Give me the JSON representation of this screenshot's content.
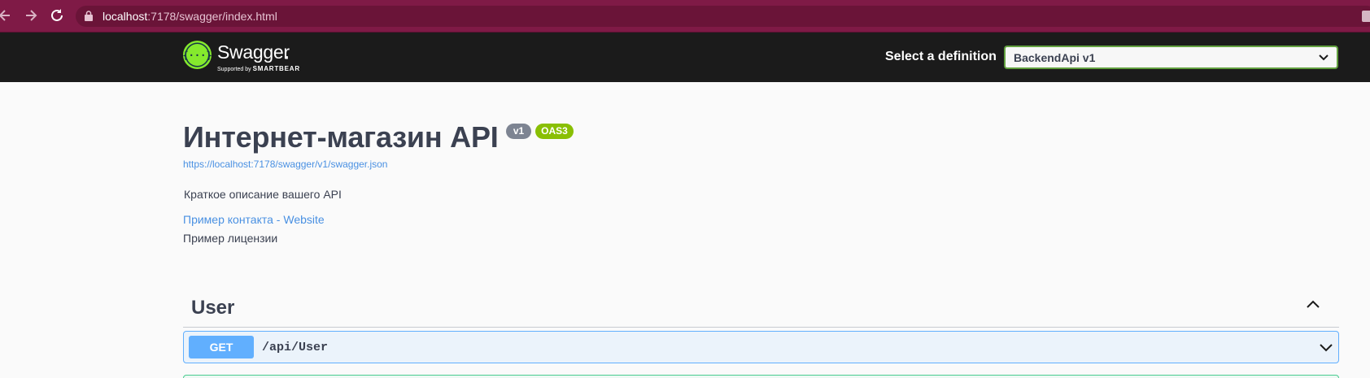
{
  "browser": {
    "url_host": "localhost",
    "url_rest": ":7178/swagger/index.html"
  },
  "topbar": {
    "logo_name": "Swagger",
    "logo_supported": "Supported by",
    "logo_company": "SMARTBEAR",
    "definition_label": "Select a definition",
    "definition_selected": "BackendApi v1"
  },
  "info": {
    "title": "Интернет-магазин API",
    "version_badge": "v1",
    "oas_badge": "OAS3",
    "spec_url": "https://localhost:7178/swagger/v1/swagger.json",
    "description": "Краткое описание вашего API",
    "contact_link": "Пример контакта - Website",
    "license_link": "Пример лицензии"
  },
  "tag": {
    "name": "User",
    "operations": [
      {
        "method": "GET",
        "path": "/api/User"
      }
    ]
  },
  "colors": {
    "browser_frame": "#7f1a46",
    "topbar": "#1b1b1b",
    "select_border": "#62a03f",
    "get_method": "#61affe",
    "oas_badge": "#89bf04",
    "version_badge": "#7d8492",
    "link": "#4990e2"
  },
  "icons": [
    "back-arrow-icon",
    "forward-arrow-icon",
    "reload-icon",
    "lock-icon",
    "swagger-logo-icon",
    "chevron-down-icon",
    "chevron-up-icon"
  ]
}
